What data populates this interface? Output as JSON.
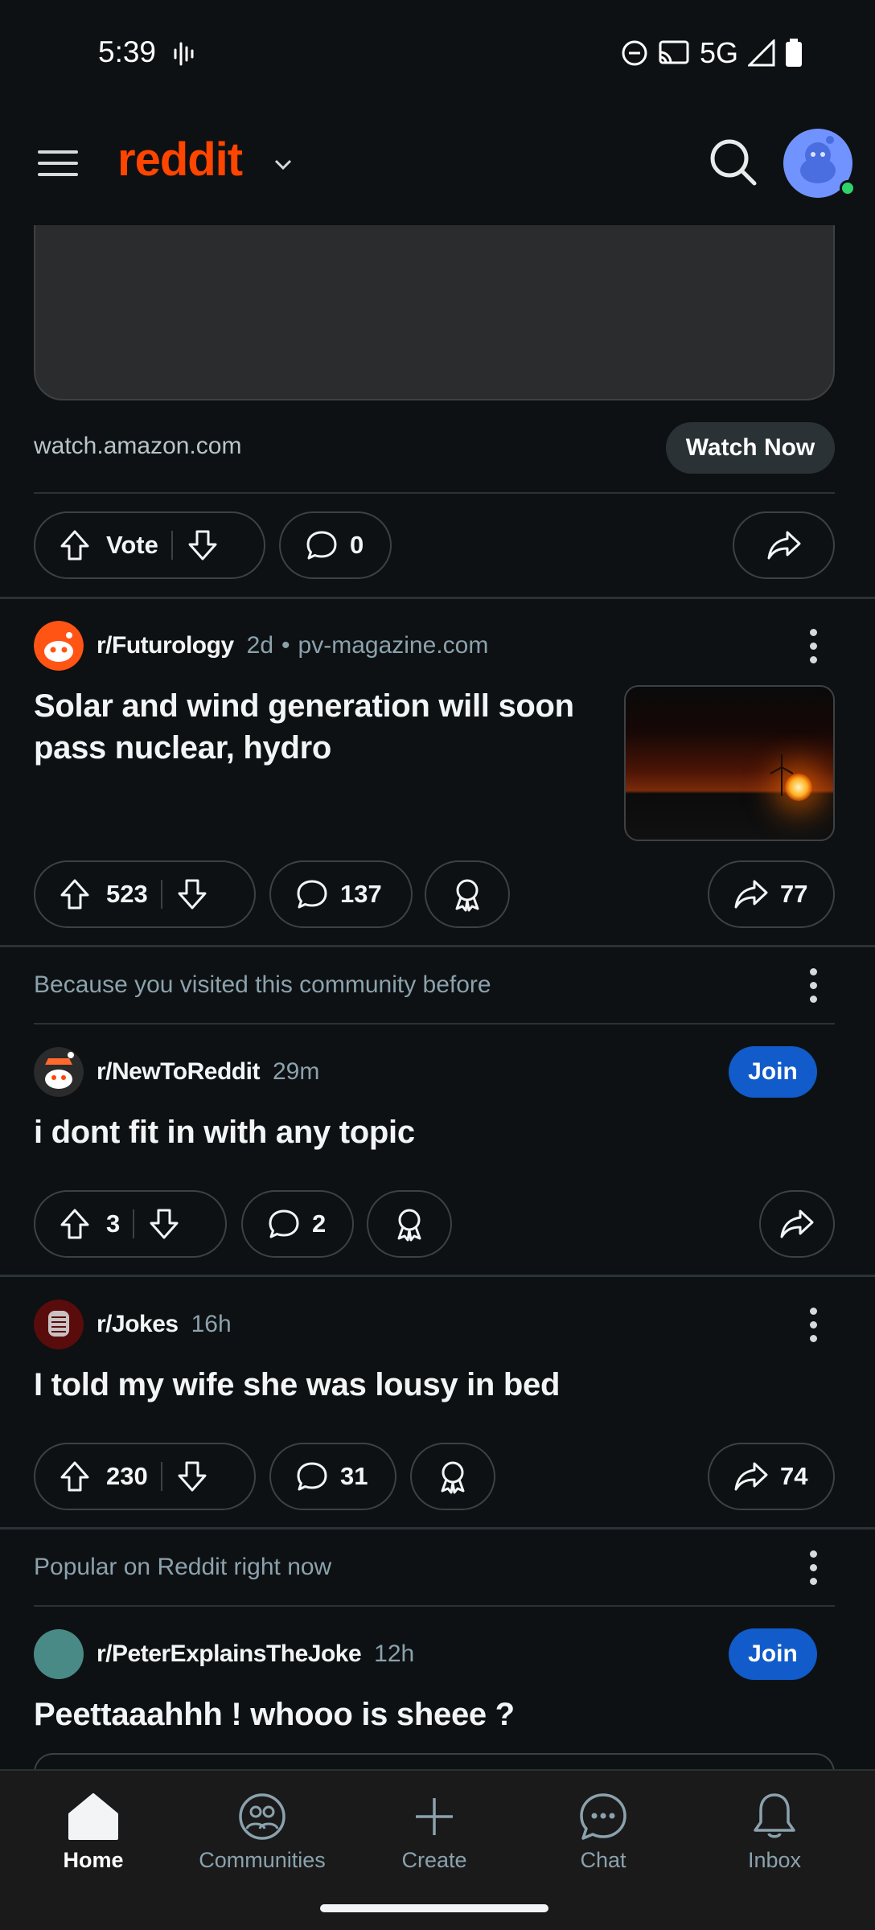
{
  "status_bar": {
    "time": "5:39",
    "network": "5G"
  },
  "header": {
    "brand": "reddit"
  },
  "ad": {
    "domain": "watch.amazon.com",
    "cta_label": "Watch Now",
    "vote_label": "Vote",
    "comments": "0"
  },
  "posts": [
    {
      "subreddit": "r/Futurology",
      "age": "2d",
      "domain": "pv-magazine.com",
      "title": "Solar and wind generation will soon pass nuclear, hydro",
      "score": "523",
      "comments": "137",
      "shares": "77",
      "thumbnail": "sunset-wind-turbine"
    },
    {
      "reason": "Because you visited this community before",
      "subreddit": "r/NewToReddit",
      "age": "29m",
      "join_label": "Join",
      "title": "i dont fit in with any topic",
      "score": "3",
      "comments": "2"
    },
    {
      "subreddit": "r/Jokes",
      "age": "16h",
      "title": "I told my wife she was lousy in bed",
      "score": "230",
      "comments": "31",
      "shares": "74"
    },
    {
      "reason": "Popular on Reddit right now",
      "subreddit": "r/PeterExplainsTheJoke",
      "age": "12h",
      "join_label": "Join",
      "title": "Peettaaahhh ! whooo is sheee ?"
    }
  ],
  "bottom_nav": [
    {
      "label": "Home",
      "icon": "home-icon",
      "active": true
    },
    {
      "label": "Communities",
      "icon": "communities-icon"
    },
    {
      "label": "Create",
      "icon": "plus-icon"
    },
    {
      "label": "Chat",
      "icon": "chat-icon"
    },
    {
      "label": "Inbox",
      "icon": "bell-icon"
    }
  ],
  "colors": {
    "brand": "#ff4500",
    "join": "#115bca",
    "background": "#0e1113"
  }
}
